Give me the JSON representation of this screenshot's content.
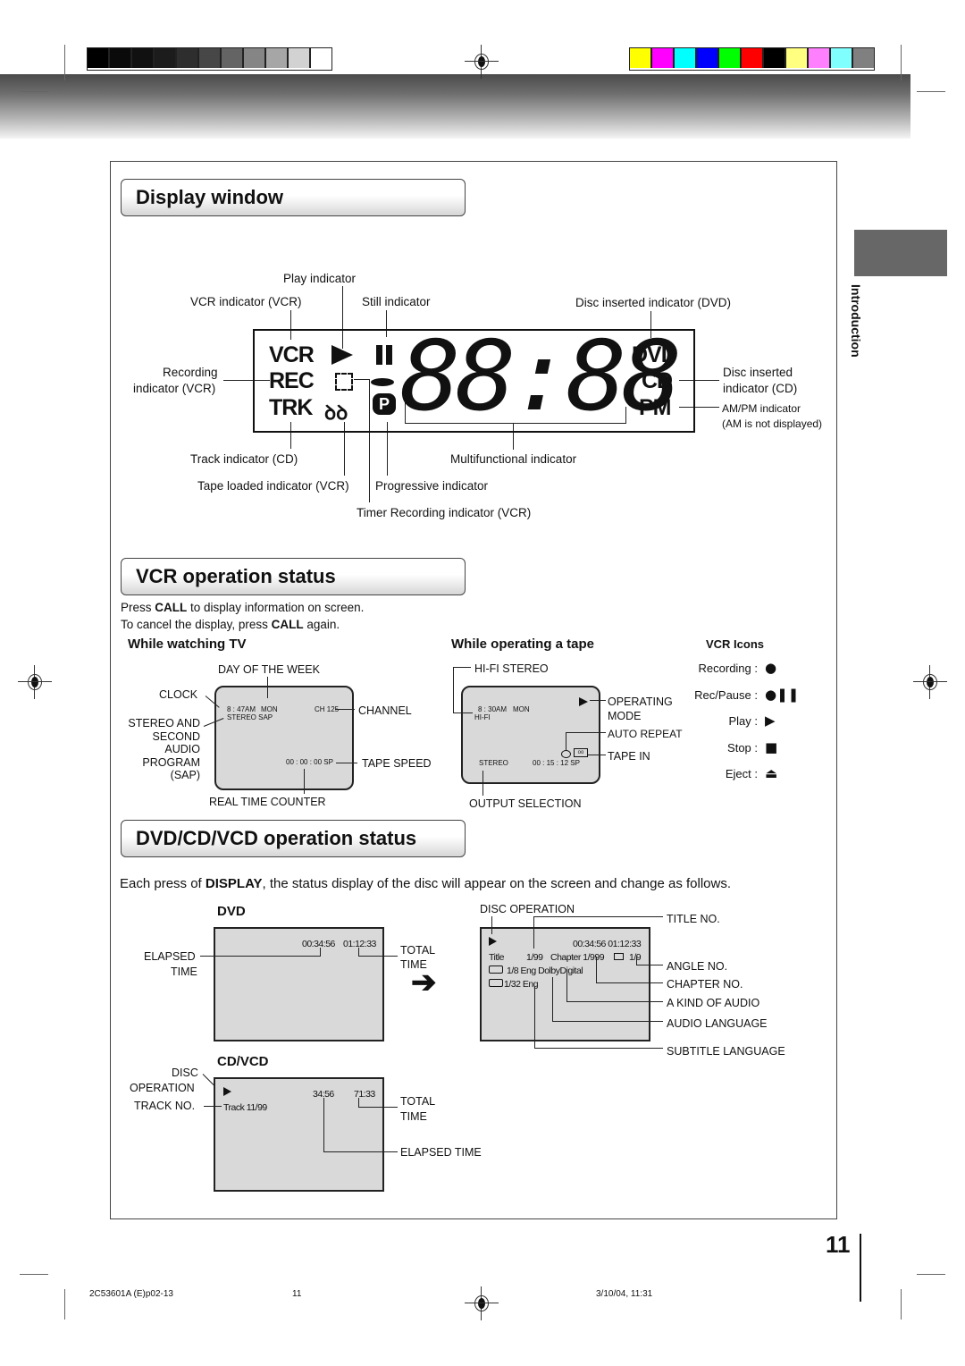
{
  "header": {
    "gray_swatches": [
      "#000000",
      "#0a0a0a",
      "#111111",
      "#1c1c1c",
      "#2e2e2e",
      "#474747",
      "#646464",
      "#858585",
      "#a6a6a6",
      "#d2d2d2",
      "#ffffff"
    ],
    "color_swatches": [
      "#ffff00",
      "#ff00ff",
      "#00ffff",
      "#0000ff",
      "#00ff00",
      "#ff0000",
      "#000000",
      "#ffff80",
      "#ff80ff",
      "#80ffff",
      "#808080"
    ]
  },
  "side_tab": {
    "label": "Introduction"
  },
  "display_window": {
    "title": "Display window",
    "lcd": {
      "vcr": "VCR",
      "rec": "REC",
      "trk": "TRK",
      "dvd": "DVD",
      "cd": "CD",
      "pm": "PM",
      "p": "P",
      "digits": "88:88"
    },
    "labels": {
      "play": "Play indicator",
      "vcr": "VCR indicator (VCR)",
      "still": "Still indicator",
      "disc_dvd": "Disc inserted indicator (DVD)",
      "rec_1": "Recording",
      "rec_2": "indicator (VCR)",
      "disc_cd_1": "Disc inserted",
      "disc_cd_2": "indicator (CD)",
      "ampm_1": "AM/PM indicator",
      "ampm_2": "(AM is not displayed)",
      "track": "Track indicator (CD)",
      "multi": "Multifunctional indicator",
      "tape": "Tape loaded indicator (VCR)",
      "progressive": "Progressive indicator",
      "timer": "Timer Recording indicator (VCR)"
    }
  },
  "vcr_status": {
    "title": "VCR operation status",
    "line1_pre": "Press ",
    "line1_bold": "CALL",
    "line1_post": " to display information on screen.",
    "line2_pre": "To cancel the display, press ",
    "line2_bold": "CALL",
    "line2_post": " again.",
    "watching": {
      "heading": "While watching TV",
      "screen": {
        "clock": "8 : 47AM",
        "day": "MON",
        "channel": "CH  125",
        "audio": "STEREO  SAP",
        "counter": "00 : 00 : 00  SP"
      },
      "labels": {
        "day": "DAY OF THE WEEK",
        "clock": "CLOCK",
        "channel": "CHANNEL",
        "stereo": [
          "STEREO AND",
          "SECOND",
          "AUDIO",
          "PROGRAM",
          "(SAP)"
        ],
        "speed": "TAPE SPEED",
        "counter": "REAL TIME COUNTER"
      }
    },
    "operating": {
      "heading": "While operating a tape",
      "screen": {
        "clock": "8 : 30AM",
        "day": "MON",
        "hifi": "HI-FI",
        "stereo": "STEREO",
        "counter": "00 : 15 : 12  SP"
      },
      "labels": {
        "hifi": "HI-FI STEREO",
        "mode_1": "OPERATING",
        "mode_2": "MODE",
        "repeat": "AUTO REPEAT",
        "tape": "TAPE IN",
        "output": "OUTPUT SELECTION"
      }
    },
    "icons": {
      "heading": "VCR Icons",
      "items": [
        {
          "label": "Recording :",
          "icon": "●"
        },
        {
          "label": "Rec/Pause :",
          "icon": "●❚❚"
        },
        {
          "label": "Play :",
          "icon": "▶"
        },
        {
          "label": "Stop :",
          "icon": "■"
        },
        {
          "label": "Eject :",
          "icon": "⏏"
        }
      ]
    }
  },
  "dvd_status": {
    "title": "DVD/CD/VCD operation status",
    "intro_pre": "Each press of ",
    "intro_bold": "DISPLAY",
    "intro_post": ", the status display of the disc will appear on the screen and change as follows.",
    "dvd": {
      "heading": "DVD",
      "screen": {
        "elapsed": "00:34:56",
        "total": "01:12:33"
      },
      "labels": {
        "elapsed_1": "ELAPSED",
        "elapsed_2": "TIME",
        "total_1": "TOTAL",
        "total_2": "TIME"
      }
    },
    "dvd_detail": {
      "screen": {
        "play": "▶",
        "time": "00:34:56  01:12:33",
        "title": "Title",
        "title_no": "1/99",
        "chapter": "Chapter  1/999",
        "angle": "1/9",
        "audio": "1/8  Eng DolbyDigital",
        "subtitle": "1/32  Eng"
      },
      "labels": {
        "disc_op": "DISC OPERATION",
        "title_no": "TITLE NO.",
        "angle": "ANGLE NO.",
        "chapter": "CHAPTER NO.",
        "kind": "A KIND OF AUDIO",
        "audio_lang": "AUDIO LANGUAGE",
        "sub_lang": "SUBTITLE LANGUAGE"
      }
    },
    "cd": {
      "heading": "CD/VCD",
      "screen": {
        "play": "▶",
        "elapsed": "34:56",
        "total": "71:33",
        "track": "Track 11/99"
      },
      "labels": {
        "disc_1": "DISC",
        "disc_2": "OPERATION",
        "track": "TRACK NO.",
        "total_1": "TOTAL",
        "total_2": "TIME",
        "elapsed": "ELAPSED TIME"
      }
    }
  },
  "footer": {
    "page_number": "11",
    "doc_code": "2C53601A (E)p02-13",
    "doc_page": "11",
    "timestamp": "3/10/04, 11:31"
  }
}
